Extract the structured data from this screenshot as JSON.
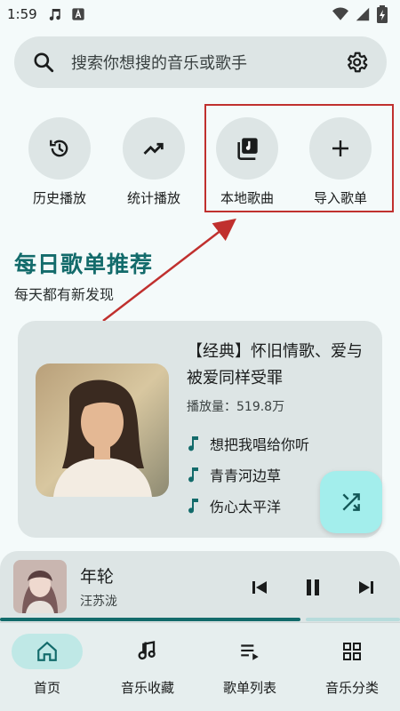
{
  "status_bar": {
    "time": "1:59",
    "icons": [
      "music-note-icon",
      "text-a-icon",
      "wifi-icon",
      "signal-icon",
      "battery-charging-icon"
    ]
  },
  "search": {
    "placeholder": "搜索你想搜的音乐或歌手",
    "icon": "search-icon",
    "settings_icon": "gear-icon"
  },
  "quick_actions": [
    {
      "label": "历史播放",
      "icon": "history-icon"
    },
    {
      "label": "统计播放",
      "icon": "trending-up-icon"
    },
    {
      "label": "本地歌曲",
      "icon": "music-library-icon"
    },
    {
      "label": "导入歌单",
      "icon": "plus-icon"
    }
  ],
  "daily": {
    "title": "每日歌单推荐",
    "subtitle": "每天都有新发现",
    "playlist_title": "【经典】怀旧情歌、爱与被爱同样受罪",
    "plays": "播放量：519.8万",
    "songs": [
      "想把我唱给你听",
      "青青河边草",
      "伤心太平洋"
    ],
    "shuffle_icon": "shuffle-icon"
  },
  "player": {
    "title": "年轮",
    "artist": "汪苏泷",
    "progress": 0.75,
    "prev_icon": "skip-previous-icon",
    "pause_icon": "pause-icon",
    "next_icon": "skip-next-icon"
  },
  "nav": [
    {
      "label": "首页",
      "icon": "home-icon",
      "active": true
    },
    {
      "label": "音乐收藏",
      "icon": "music-favorite-icon",
      "active": false
    },
    {
      "label": "歌单列表",
      "icon": "playlist-icon",
      "active": false
    },
    {
      "label": "音乐分类",
      "icon": "grid-icon",
      "active": false
    }
  ],
  "colors": {
    "accent": "#136b6b",
    "surface": "#dde5e5",
    "fab": "#a3eeec",
    "annotation_red": "#c0302e"
  }
}
